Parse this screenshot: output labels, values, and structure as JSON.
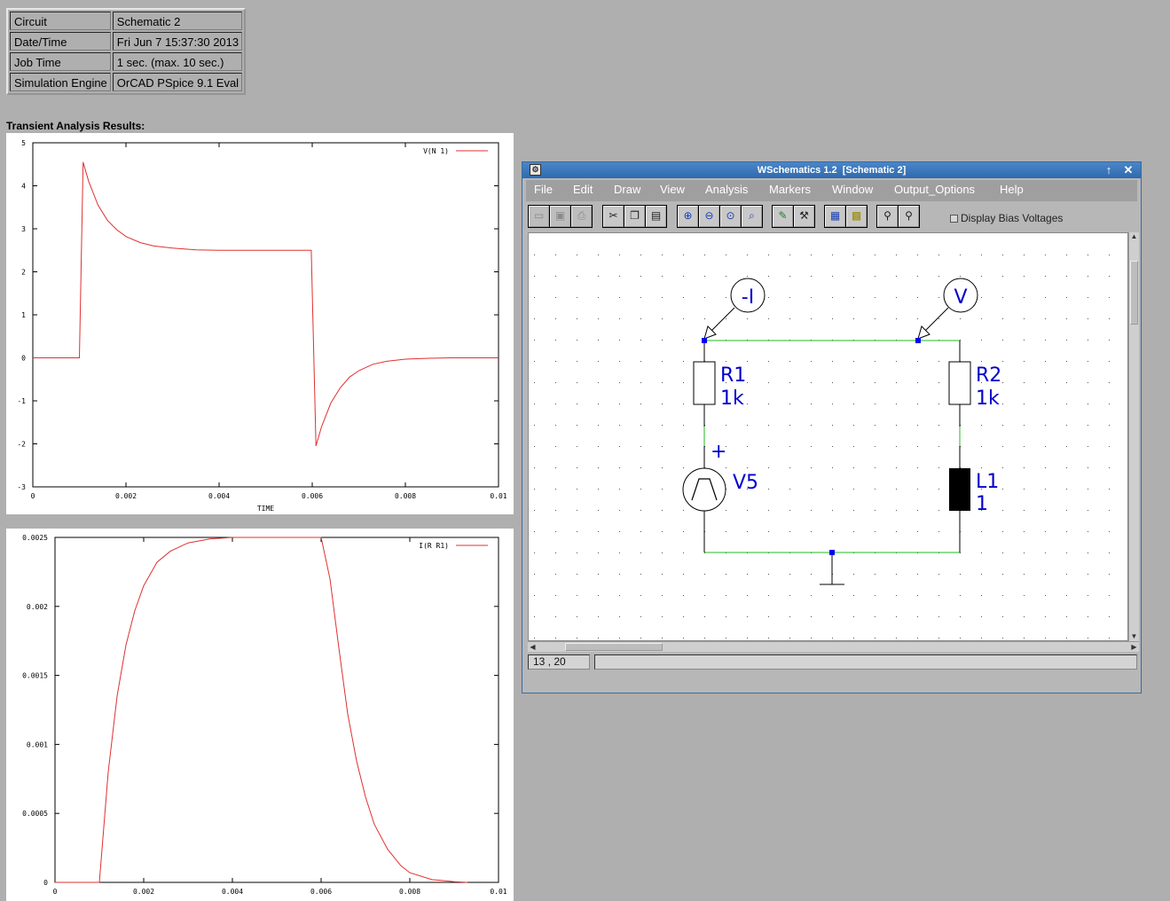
{
  "info": {
    "rows": [
      {
        "label": "Circuit",
        "value": "Schematic 2"
      },
      {
        "label": "Date/Time",
        "value": "Fri Jun 7 15:37:30 2013"
      },
      {
        "label": "Job Time",
        "value": "1 sec. (max. 10 sec.)"
      },
      {
        "label": "Simulation Engine",
        "value": "OrCAD PSpice 9.1 Eval"
      }
    ]
  },
  "results_heading": "Transient Analysis Results:",
  "chart_data": [
    {
      "type": "line",
      "legend": "V(N 1)",
      "xlabel": "TIME",
      "xlim": [
        0,
        0.01
      ],
      "ylim": [
        -3,
        5
      ],
      "x_ticks": [
        "0",
        "0.002",
        "0.004",
        "0.006",
        "0.008",
        "0.01"
      ],
      "y_ticks": [
        "5",
        "4",
        "3",
        "2",
        "1",
        "0",
        "-1",
        "-2",
        "-3"
      ],
      "series": [
        {
          "name": "V(N 1)",
          "x": [
            0,
            0.001,
            0.00108,
            0.0012,
            0.0014,
            0.0016,
            0.0018,
            0.002,
            0.0023,
            0.0026,
            0.003,
            0.0035,
            0.004,
            0.005,
            0.00598,
            0.00608,
            0.0062,
            0.0064,
            0.0066,
            0.0068,
            0.007,
            0.0073,
            0.0076,
            0.008,
            0.0085,
            0.009,
            0.01
          ],
          "y": [
            0,
            0,
            4.55,
            4.1,
            3.55,
            3.2,
            2.98,
            2.82,
            2.68,
            2.6,
            2.55,
            2.51,
            2.5,
            2.5,
            2.5,
            -2.05,
            -1.6,
            -1.05,
            -0.7,
            -0.45,
            -0.3,
            -0.15,
            -0.08,
            -0.03,
            -0.01,
            0,
            0
          ]
        }
      ]
    },
    {
      "type": "line",
      "legend": "I(R R1)",
      "xlim": [
        0,
        0.01
      ],
      "ylim": [
        0,
        0.0025
      ],
      "x_ticks": [
        "0",
        "0.002",
        "0.004",
        "0.006",
        "0.008",
        "0.01"
      ],
      "y_ticks": [
        "0.0025",
        "0.002",
        "0.0015",
        "0.001",
        "0.0005",
        "0"
      ],
      "series": [
        {
          "name": "I(R R1)",
          "x": [
            0,
            0.001,
            0.0012,
            0.0014,
            0.0016,
            0.0018,
            0.002,
            0.0023,
            0.0026,
            0.003,
            0.0035,
            0.004,
            0.005,
            0.006,
            0.0062,
            0.0064,
            0.0066,
            0.0068,
            0.007,
            0.0072,
            0.0075,
            0.0078,
            0.008,
            0.0085,
            0.009,
            0.0093
          ],
          "y": [
            0,
            0,
            0.0008,
            0.00135,
            0.00172,
            0.00197,
            0.00215,
            0.00232,
            0.0024,
            0.00246,
            0.00249,
            0.0025,
            0.0025,
            0.0025,
            0.0022,
            0.0017,
            0.00122,
            0.00088,
            0.00062,
            0.00042,
            0.00024,
            0.00012,
            7e-05,
            2e-05,
            5e-06,
            0
          ]
        }
      ]
    }
  ],
  "window": {
    "title": "WSchematics 1.2  [Schematic 2]",
    "menu": [
      "File",
      "Edit",
      "Draw",
      "View",
      "Analysis",
      "Markers",
      "Window",
      "Output_Options",
      "Help"
    ],
    "toolbar_groups": [
      [
        "open-folder-icon",
        "save-icon",
        "print-icon"
      ],
      [
        "cut-icon",
        "copy-icon",
        "paste-icon"
      ],
      [
        "zoom-in-icon",
        "zoom-out-icon",
        "zoom-area-icon",
        "zoom-fit-icon"
      ],
      [
        "wire-icon",
        "part-icon"
      ],
      [
        "netlist-icon",
        "graph-icon"
      ],
      [
        "probe-voltage-icon",
        "probe-current-icon"
      ]
    ],
    "bias_label": "Display Bias Voltages",
    "coords": "13 , 20",
    "schematic": {
      "probe_current_label": "-I",
      "probe_voltage_label": "V",
      "r1_name": "R1",
      "r1_value": "1k",
      "r2_name": "R2",
      "r2_value": "1k",
      "v_name": "V5",
      "v_plus": "+",
      "l_name": "L1",
      "l_value": "1"
    }
  }
}
